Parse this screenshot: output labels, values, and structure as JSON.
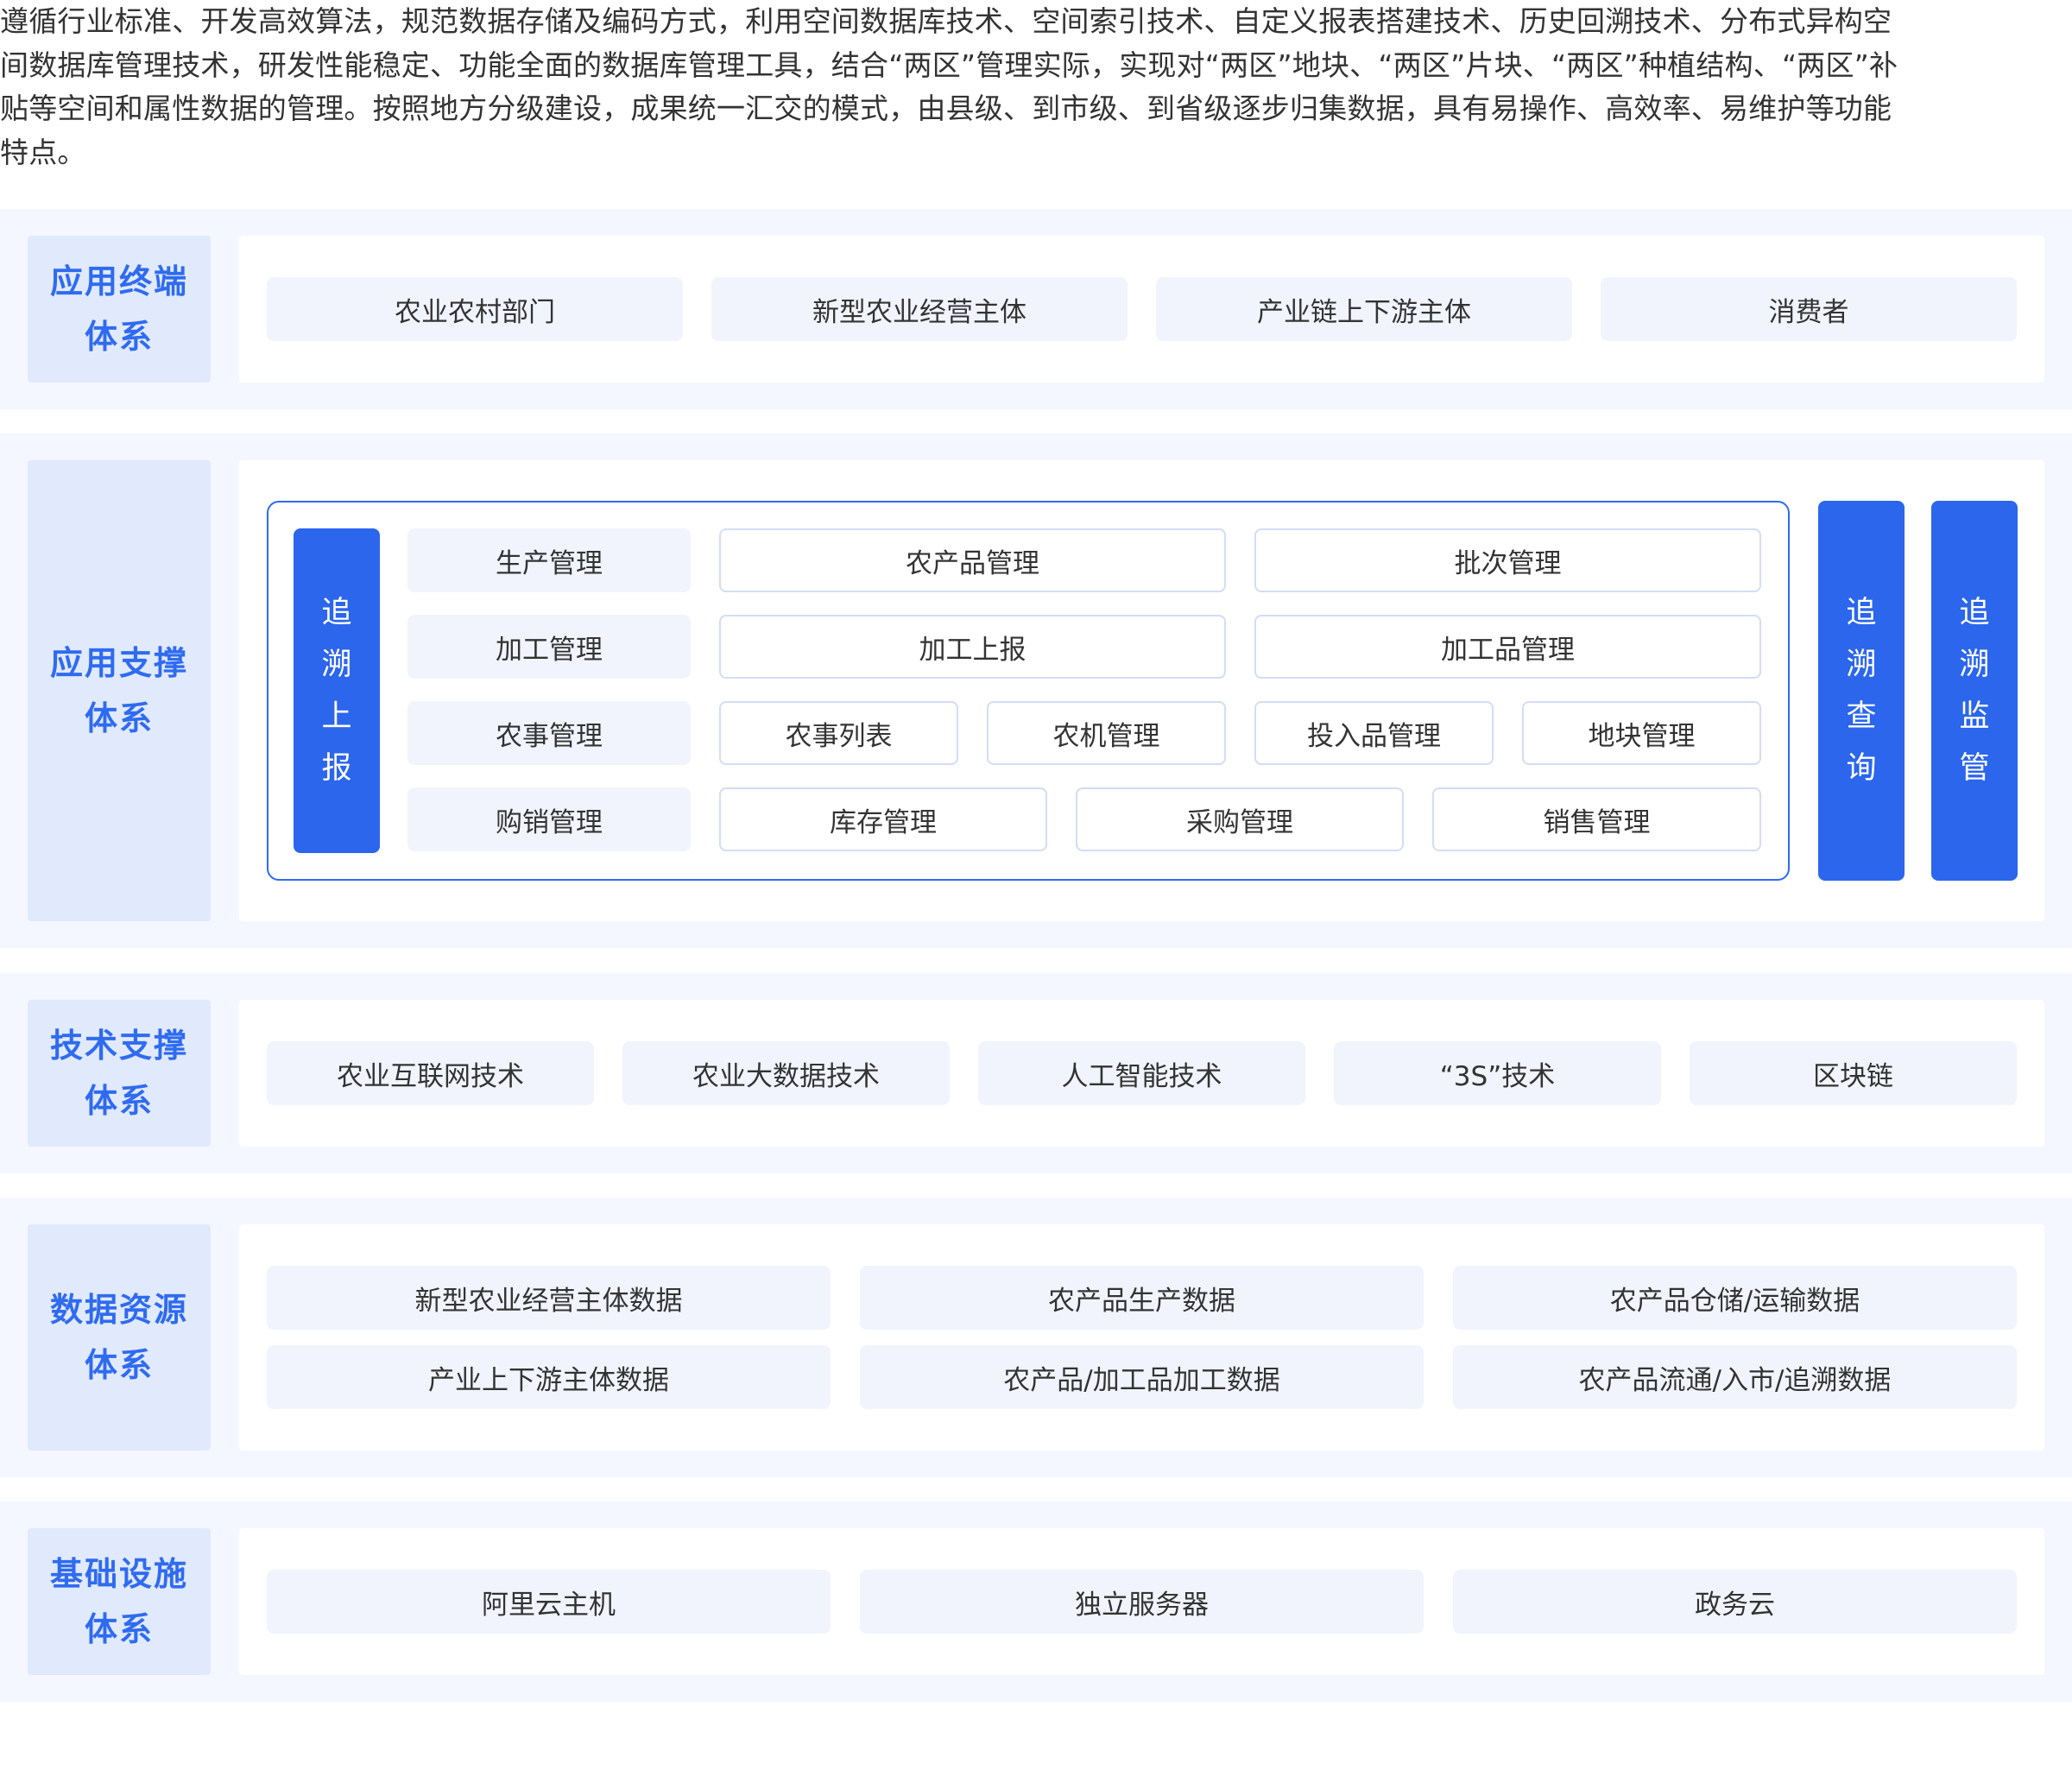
{
  "intro": {
    "lines": [
      "遵循行业标准、开发高效算法，规范数据存储及编码方式，利用空间数据库技术、空间索引技术、自定义报表搭建技术、历史回溯技术、分布式异构空",
      "间数据库管理技术，研发性能稳定、功能全面的数据库管理工具，结合“两区”管理实际，实现对“两区”地块、“两区”片块、“两区”种植结构、“两区”补",
      "贴等空间和属性数据的管理。按照地方分级建设，成果统一汇交的模式，由县级、到市级、到省级逐步归集数据，具有易操作、高效率、易维护等功能",
      "特点。"
    ]
  },
  "layers": {
    "terminal": {
      "label_line1": "应用终端",
      "label_line2": "体系",
      "items": [
        "农业农村部门",
        "新型农业经营主体",
        "产业链上下游主体",
        "消费者"
      ]
    },
    "support": {
      "label_line1": "应用支撑",
      "label_line2": "体系",
      "report_bar": [
        "追",
        "溯",
        "上",
        "报"
      ],
      "query_bar": [
        "追",
        "溯",
        "查",
        "询"
      ],
      "monitor_bar": [
        "追",
        "溯",
        "监",
        "管"
      ],
      "rows": [
        {
          "name": "生产管理",
          "items": [
            "农产品管理",
            "批次管理"
          ]
        },
        {
          "name": "加工管理",
          "items": [
            "加工上报",
            "加工品管理"
          ]
        },
        {
          "name": "农事管理",
          "items": [
            "农事列表",
            "农机管理",
            "投入品管理",
            "地块管理"
          ]
        },
        {
          "name": "购销管理",
          "items": [
            "库存管理",
            "采购管理",
            "销售管理"
          ]
        }
      ]
    },
    "tech": {
      "label_line1": "技术支撑",
      "label_line2": "体系",
      "items": [
        "农业互联网技术",
        "农业大数据技术",
        "人工智能技术",
        "“3S”技术",
        "区块链"
      ]
    },
    "data": {
      "label_line1": "数据资源",
      "label_line2": "体系",
      "items": [
        "新型农业经营主体数据",
        "农产品生产数据",
        "农产品仓储/运输数据",
        "产业上下游主体数据",
        "农产品/加工品加工数据",
        "农产品流通/入市/追溯数据"
      ]
    },
    "infra": {
      "label_line1": "基础设施",
      "label_line2": "体系",
      "items": [
        "阿里云主机",
        "独立服务器",
        "政务云"
      ]
    }
  },
  "colors": {
    "accent": "#2b66ec",
    "label_bg": "#e1e9fd",
    "layer_bg": "#f4f7ff",
    "pill_bg": "#f1f4fd",
    "text": "#333333"
  }
}
